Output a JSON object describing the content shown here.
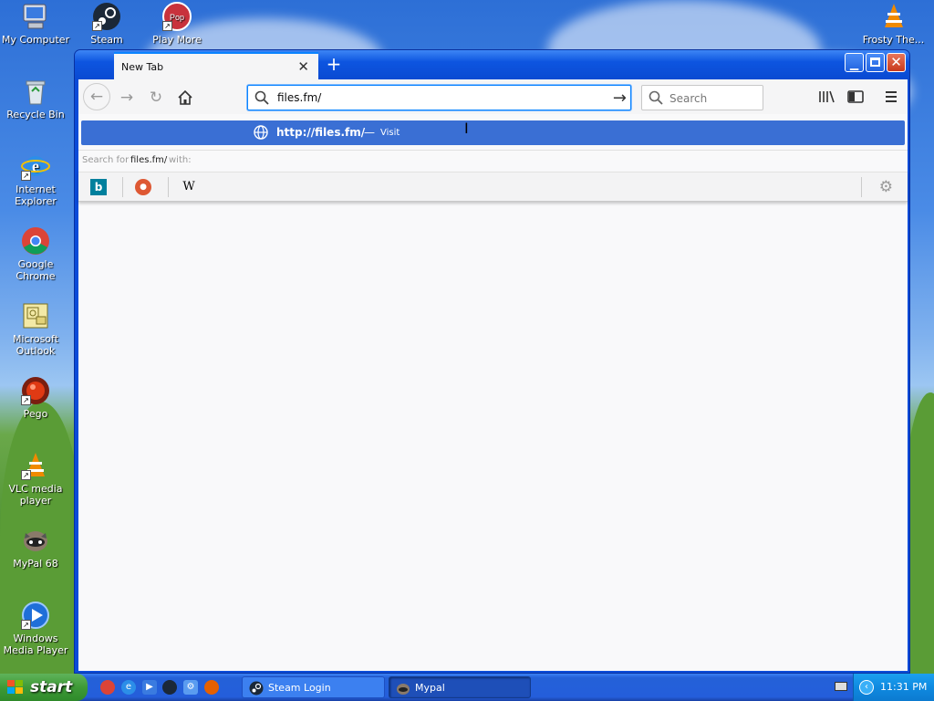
{
  "desktop": {
    "icons": [
      {
        "label": "My Computer"
      },
      {
        "label": "Steam"
      },
      {
        "label": "Play More"
      },
      {
        "label": "Frosty The..."
      },
      {
        "label": "Recycle Bin"
      },
      {
        "label": "Internet Explorer"
      },
      {
        "label": "Google Chrome"
      },
      {
        "label": "Microsoft Outlook"
      },
      {
        "label": "Pego"
      },
      {
        "label": "VLC media player"
      },
      {
        "label": "MyPal 68"
      },
      {
        "label": "Windows Media Player"
      }
    ]
  },
  "browser": {
    "tab_title": "New Tab",
    "url_value": "files.fm/",
    "search_placeholder": "Search",
    "suggestion": {
      "url": "http://files.fm/",
      "dash": "—",
      "action": "Visit"
    },
    "search_for": {
      "prefix": "Search for",
      "query": "files.fm/",
      "suffix": "with:"
    },
    "engines": [
      "bing",
      "duckduckgo",
      "wikipedia"
    ],
    "wikipedia_label": "W"
  },
  "taskbar": {
    "start_label": "start",
    "buttons": [
      {
        "label": "Steam Login"
      },
      {
        "label": "Mypal"
      }
    ],
    "clock": "11:31 PM"
  }
}
